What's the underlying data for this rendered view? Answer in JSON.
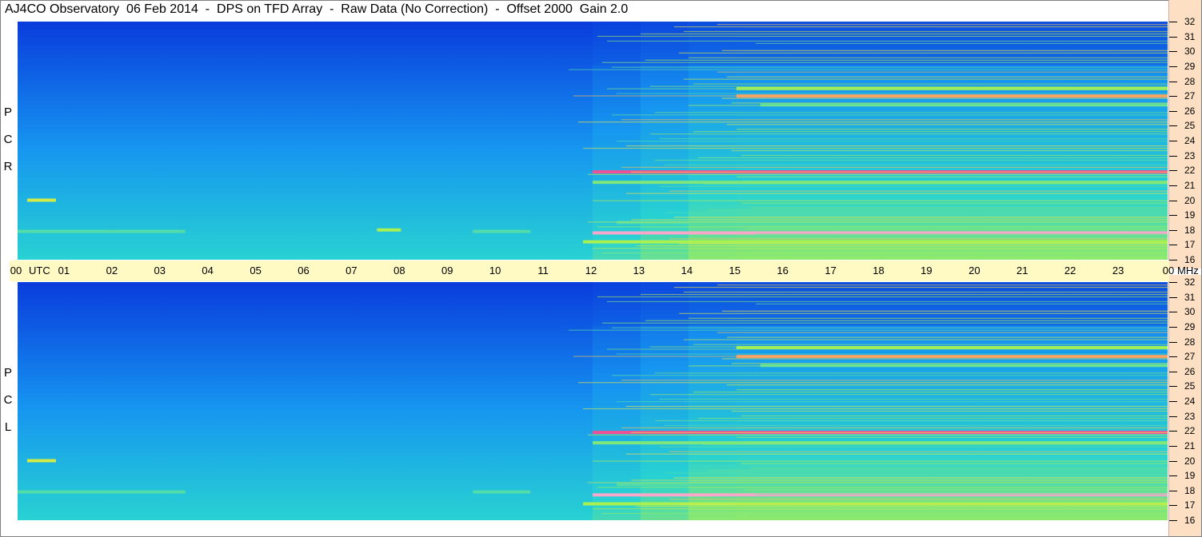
{
  "title": "AJ4CO Observatory  06 Feb 2014  -  DPS on TFD Array  -  Raw Data (No Correction)  -  Offset 2000  Gain 2.0",
  "panels": [
    {
      "id": "top",
      "polarization_label": [
        "R",
        "C",
        "P"
      ]
    },
    {
      "id": "bot",
      "polarization_label": [
        "L",
        "C",
        "P"
      ]
    }
  ],
  "time_axis": {
    "ticks": [
      "00",
      "01",
      "02",
      "03",
      "04",
      "05",
      "06",
      "07",
      "08",
      "09",
      "10",
      "11",
      "12",
      "13",
      "14",
      "15",
      "16",
      "17",
      "18",
      "19",
      "20",
      "21",
      "22",
      "23",
      "00"
    ],
    "unit_label": "UTC",
    "freq_unit_label": "MHz"
  },
  "chart_data": [
    {
      "type": "heatmap",
      "panel": "RCP",
      "xlabel": "UTC",
      "ylabel": "MHz",
      "xlim": [
        0,
        24
      ],
      "ylim": [
        16,
        32
      ],
      "y_ticks": [
        16,
        17,
        18,
        19,
        20,
        21,
        22,
        23,
        24,
        25,
        26,
        27,
        28,
        29,
        30,
        31,
        32
      ],
      "x_ticks": [
        "00",
        "01",
        "02",
        "03",
        "04",
        "05",
        "06",
        "07",
        "08",
        "09",
        "10",
        "11",
        "12",
        "13",
        "14",
        "15",
        "16",
        "17",
        "18",
        "19",
        "20",
        "21",
        "22",
        "23",
        "00"
      ],
      "intensity_bands": [
        {
          "freq": 17.8,
          "from": 12,
          "to": 24,
          "level": 0.95
        },
        {
          "freq": 17.2,
          "from": 11.8,
          "to": 24,
          "level": 0.7
        },
        {
          "freq": 18.5,
          "from": 12.5,
          "to": 24,
          "level": 0.6
        },
        {
          "freq": 21.2,
          "from": 12,
          "to": 24,
          "level": 0.65
        },
        {
          "freq": 21.9,
          "from": 12,
          "to": 24,
          "level": 0.9
        },
        {
          "freq": 27.0,
          "from": 15,
          "to": 24,
          "level": 0.85
        },
        {
          "freq": 27.5,
          "from": 15,
          "to": 24,
          "level": 0.7
        },
        {
          "freq": 26.4,
          "from": 15.5,
          "to": 24,
          "level": 0.6
        },
        {
          "freq": 20.0,
          "from": 0.2,
          "to": 0.8,
          "level": 0.75
        },
        {
          "freq": 17.9,
          "from": 0,
          "to": 3.5,
          "level": 0.6
        },
        {
          "freq": 17.9,
          "from": 9.5,
          "to": 10.7,
          "level": 0.6
        },
        {
          "freq": 18.0,
          "from": 7.5,
          "to": 8.0,
          "level": 0.7
        }
      ]
    },
    {
      "type": "heatmap",
      "panel": "LCP",
      "xlabel": "UTC",
      "ylabel": "MHz",
      "xlim": [
        0,
        24
      ],
      "ylim": [
        16,
        32
      ],
      "y_ticks": [
        16,
        17,
        18,
        19,
        20,
        21,
        22,
        23,
        24,
        25,
        26,
        27,
        28,
        29,
        30,
        31,
        32
      ],
      "intensity_bands": [
        {
          "freq": 17.7,
          "from": 12,
          "to": 24,
          "level": 0.95
        },
        {
          "freq": 17.1,
          "from": 11.8,
          "to": 24,
          "level": 0.7
        },
        {
          "freq": 18.4,
          "from": 12.5,
          "to": 24,
          "level": 0.6
        },
        {
          "freq": 21.2,
          "from": 12,
          "to": 24,
          "level": 0.65
        },
        {
          "freq": 21.9,
          "from": 12,
          "to": 24,
          "level": 0.9
        },
        {
          "freq": 27.0,
          "from": 15,
          "to": 24,
          "level": 0.85
        },
        {
          "freq": 27.6,
          "from": 15,
          "to": 24,
          "level": 0.7
        },
        {
          "freq": 26.4,
          "from": 15.5,
          "to": 24,
          "level": 0.6
        },
        {
          "freq": 20.0,
          "from": 0.2,
          "to": 0.8,
          "level": 0.75
        },
        {
          "freq": 17.9,
          "from": 0,
          "to": 3.5,
          "level": 0.6
        },
        {
          "freq": 17.9,
          "from": 9.5,
          "to": 10.7,
          "level": 0.6
        }
      ]
    }
  ],
  "colors": {
    "background_low": "#0a2a9a",
    "mid": "#19b4f0",
    "high": "#a8f050",
    "peak": "#f0508a",
    "max": "#ffffff",
    "axis_bar": "#fff9c4",
    "mhz_bar": "#fde0c4"
  }
}
